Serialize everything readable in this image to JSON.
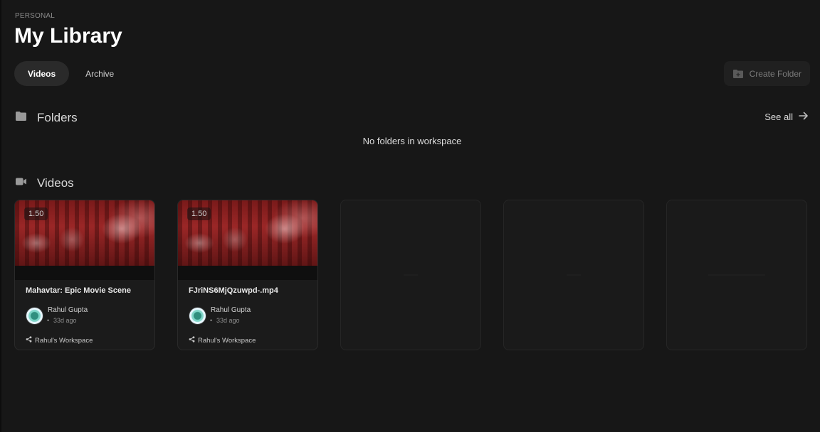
{
  "header": {
    "workspace_label": "PERSONAL",
    "title": "My Library"
  },
  "tabs": [
    {
      "label": "Videos",
      "active": true
    },
    {
      "label": "Archive",
      "active": false
    }
  ],
  "actions": {
    "create_folder_label": "Create Folder"
  },
  "folders": {
    "heading": "Folders",
    "see_all_label": "See all",
    "empty_message": "No folders in workspace"
  },
  "videos": {
    "heading": "Videos",
    "items": [
      {
        "speed": "1.50",
        "title": "Mahavtar: Epic Movie Scene",
        "author": "Rahul Gupta",
        "time": "33d ago",
        "workspace": "Rahul's Workspace"
      },
      {
        "speed": "1.50",
        "title": "FJriNS6MjQzuwpd-.mp4",
        "author": "Rahul Gupta",
        "time": "33d ago",
        "workspace": "Rahul's Workspace"
      }
    ]
  },
  "colors": {
    "background": "#171717",
    "card": "#1b1b1b",
    "tab_active": "#2a2a2a"
  },
  "icons": [
    "folder-icon",
    "video-camera-icon",
    "arrow-right-icon",
    "folder-plus-icon",
    "share-icon"
  ]
}
